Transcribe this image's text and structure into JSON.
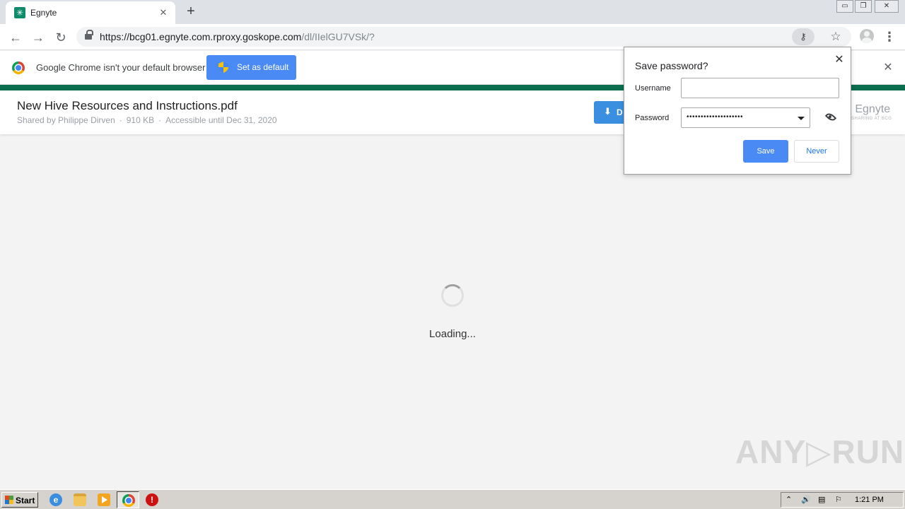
{
  "browser": {
    "tab_title": "Egnyte",
    "tab_close": "✕",
    "new_tab": "+",
    "url_host": "https://bcg01.egnyte.com.rproxy.goskope.com",
    "url_path": "/dl/IIelGU7VSk/?",
    "window_controls": [
      "▭",
      "❐",
      "✕"
    ]
  },
  "infobar": {
    "message": "Google Chrome isn't your default browser",
    "button_label": "Set as default",
    "close": "✕"
  },
  "document": {
    "title": "New Hive Resources and Instructions.pdf",
    "shared_by": "Shared by Philippe Dirven",
    "size": "910 KB",
    "accessible": "Accessible until Dec 31, 2020",
    "separator": "·",
    "download_label": "D",
    "brand": "n Egnyte",
    "brand_tag": "SHARING AT BCG",
    "loading": "Loading..."
  },
  "password_bubble": {
    "title": "Save password?",
    "close": "✕",
    "username_label": "Username",
    "username_value": "",
    "password_label": "Password",
    "password_value": "••••••••••••••••••••",
    "save_label": "Save",
    "never_label": "Never"
  },
  "watermark": "ANY▷RUN",
  "taskbar": {
    "start_label": "Start",
    "ie_glyph": "e",
    "stop_glyph": "!",
    "tray_icons": [
      "⌃",
      "🔊",
      "▤",
      "⚐"
    ],
    "clock": "1:21 PM"
  },
  "colors": {
    "egnyte_green": "#0b6e4f",
    "chrome_blue": "#4a8af4",
    "download_blue": "#3b8fe0"
  }
}
